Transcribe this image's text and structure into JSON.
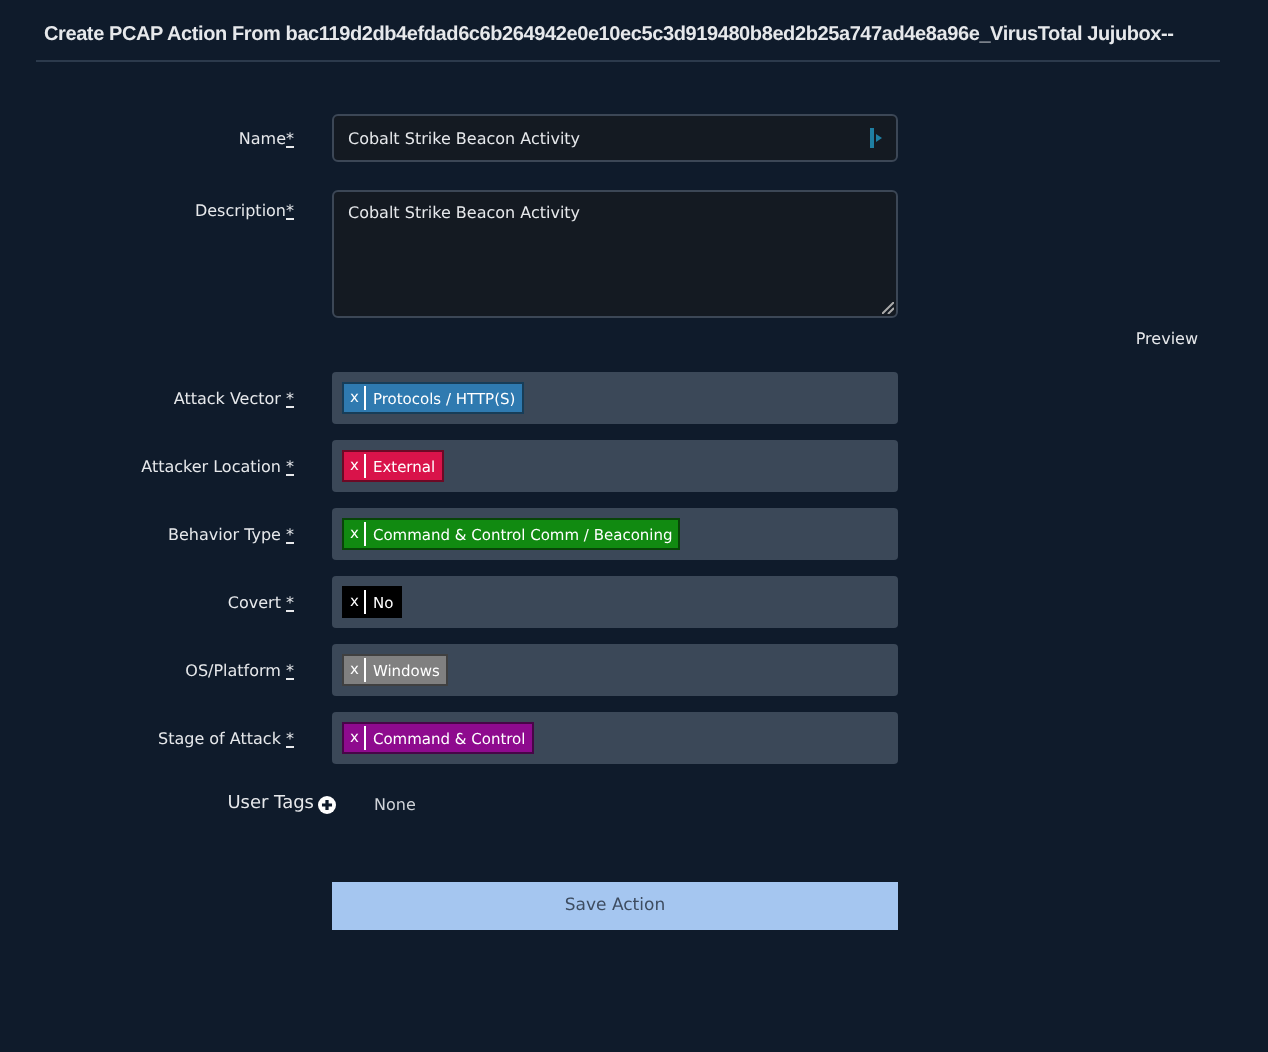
{
  "title": "Create PCAP Action From bac119d2db4efdad6c6b264942e0e10ec5c3d919480b8ed2b25a747ad4e8a96e_VirusTotal Jujubox--",
  "name_field": {
    "label": "Name",
    "required": "*",
    "value": "Cobalt Strike Beacon Activity"
  },
  "description_field": {
    "label": "Description",
    "required": "*",
    "value": "Cobalt Strike Beacon Activity"
  },
  "preview_link": "Preview",
  "tag_fields": [
    {
      "label": "Attack Vector",
      "required": "*",
      "tags": [
        {
          "remove": "x",
          "text": "Protocols / HTTP(S)",
          "color": "#2f7ab0"
        }
      ]
    },
    {
      "label": "Attacker Location",
      "required": "*",
      "tags": [
        {
          "remove": "x",
          "text": "External",
          "color": "#d9134a"
        }
      ]
    },
    {
      "label": "Behavior Type",
      "required": "*",
      "tags": [
        {
          "remove": "x",
          "text": "Command & Control Comm / Beaconing",
          "color": "#118a11"
        }
      ]
    },
    {
      "label": "Covert",
      "required": "*",
      "tags": [
        {
          "remove": "x",
          "text": "No",
          "color": "#000000"
        }
      ]
    },
    {
      "label": "OS/Platform",
      "required": "*",
      "tags": [
        {
          "remove": "x",
          "text": "Windows",
          "color": "#808080"
        }
      ]
    },
    {
      "label": "Stage of Attack",
      "required": "*",
      "tags": [
        {
          "remove": "x",
          "text": "Command & Control",
          "color": "#8e0a8e"
        }
      ]
    }
  ],
  "user_tags": {
    "label": "User Tags",
    "value": "None"
  },
  "save_button": "Save Action"
}
